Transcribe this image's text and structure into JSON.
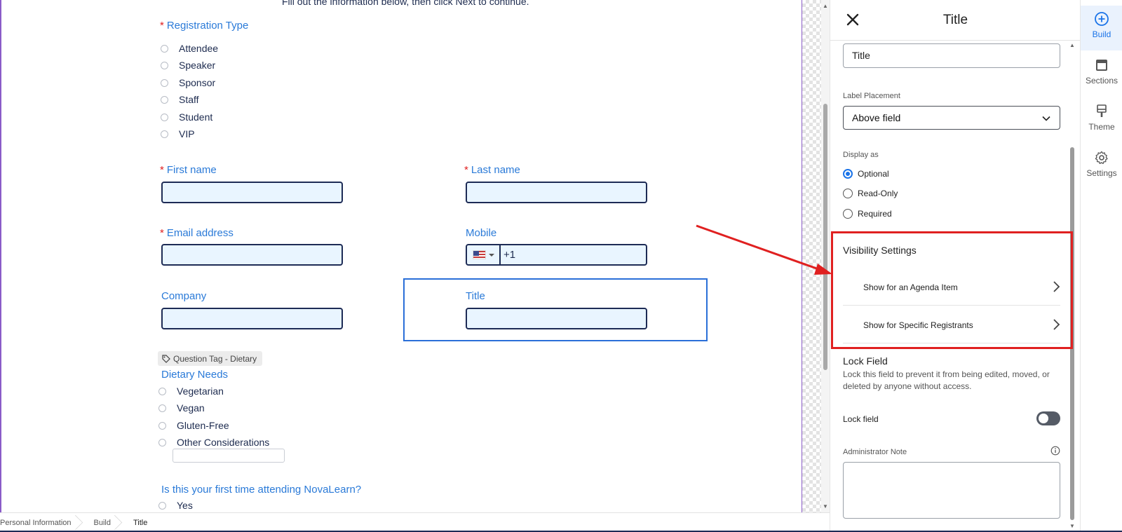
{
  "form": {
    "intro": "Fill out the information below, then click Next to continue.",
    "registration_type": {
      "label": "Registration Type",
      "options": [
        "Attendee",
        "Speaker",
        "Sponsor",
        "Staff",
        "Student",
        "VIP"
      ]
    },
    "first_name": {
      "label": "First name",
      "value": ""
    },
    "last_name": {
      "label": "Last name",
      "value": ""
    },
    "email": {
      "label": "Email address",
      "value": ""
    },
    "mobile": {
      "label": "Mobile",
      "country_code": "+1",
      "flag": "us-flag-icon"
    },
    "company": {
      "label": "Company",
      "value": ""
    },
    "title": {
      "label": "Title",
      "value": ""
    },
    "question_tag": "Question Tag - Dietary",
    "dietary": {
      "label": "Dietary Needs",
      "options": [
        "Vegetarian",
        "Vegan",
        "Gluten-Free",
        "Other Considerations"
      ]
    },
    "first_time": {
      "label": "Is this your first time attending NovaLearn?",
      "options": [
        "Yes"
      ]
    },
    "required_marker": "*"
  },
  "breadcrumb": [
    "Personal Information",
    "Build",
    "Title"
  ],
  "panel": {
    "title": "Title",
    "field_label_value": "Title",
    "label_placement_label": "Label Placement",
    "label_placement_value": "Above field",
    "display_as_label": "Display as",
    "display_options": [
      "Optional",
      "Read-Only",
      "Required"
    ],
    "display_selected": "Optional",
    "visibility_title": "Visibility Settings",
    "visibility_items": [
      "Show for an Agenda Item",
      "Show for Specific Registrants"
    ],
    "lock_title": "Lock Field",
    "lock_description": "Lock this field to prevent it from being edited, moved, or deleted by anyone without access.",
    "lock_label": "Lock field",
    "lock_enabled": false,
    "admin_note_label": "Administrator Note"
  },
  "rail": {
    "items": [
      {
        "label": "Build",
        "icon": "plus-circle-icon",
        "active": true
      },
      {
        "label": "Sections",
        "icon": "sections-icon",
        "active": false
      },
      {
        "label": "Theme",
        "icon": "paint-brush-icon",
        "active": false
      },
      {
        "label": "Settings",
        "icon": "gear-icon",
        "active": false
      }
    ]
  },
  "colors": {
    "accent": "#1a73e8",
    "label_blue": "#2a7ad8",
    "required_red": "#e02020",
    "input_fill": "#e9f5ff",
    "input_border": "#1d2b55",
    "annotation_red": "#e02020"
  }
}
